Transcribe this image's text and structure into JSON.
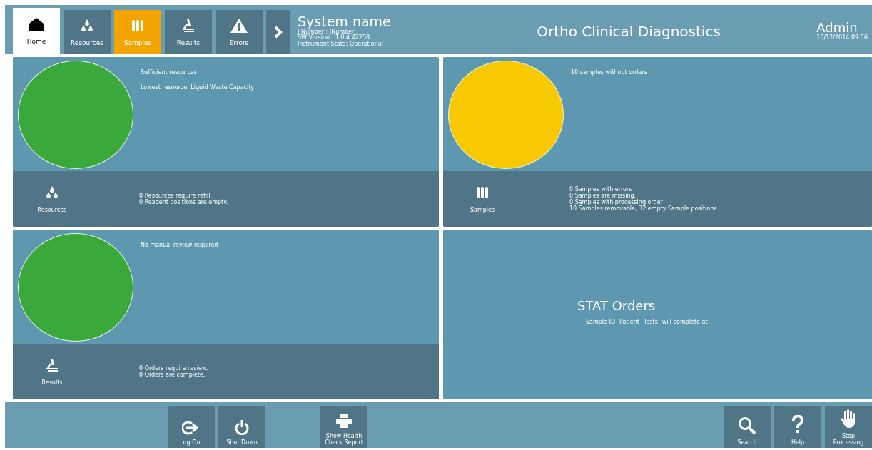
{
  "nav_tabs": [
    {
      "label": "Home",
      "kind": "home",
      "selected": true,
      "highlighted": false
    },
    {
      "label": "Resources",
      "kind": "drops",
      "selected": false,
      "highlighted": false
    },
    {
      "label": "Samples",
      "kind": "tubes",
      "selected": false,
      "highlighted": true
    },
    {
      "label": "Results",
      "kind": "microscope",
      "selected": false,
      "highlighted": false
    },
    {
      "label": "Errors",
      "kind": "warning",
      "selected": false,
      "highlighted": false
    }
  ],
  "system": {
    "name": "System name",
    "lines": [
      "J Number :  JNumber",
      "SW Version :  1.0.4.42258",
      "Instrument State: Operational"
    ]
  },
  "brand": "Ortho Clinical Diagnostics",
  "user": {
    "name": "Admin",
    "datetime": "10/12/2014 09:56"
  },
  "panels": [
    {
      "color": "#3aa83a",
      "messages": [
        "Sufficient resources",
        "Lowest resource: Liquid Waste Capacity"
      ],
      "kind": "drops",
      "label": "Resources",
      "details": [
        "0 Resources require refill.",
        "0 Reagent positions are empty."
      ]
    },
    {
      "color": "#f8c800",
      "messages": [
        "10 samples without orders"
      ],
      "kind": "tubes",
      "label": "Samples",
      "details": [
        "0 Samples with errors",
        "0 Samples are missing.",
        "0 Samples with processing order",
        "10 Samples removable, 32 empty Sample positions"
      ]
    },
    {
      "color": "#3aa83a",
      "messages": [
        "No manual review required"
      ],
      "kind": "microscope",
      "label": "Results",
      "details": [
        "0 Orders require review.",
        "0 Orders are complete."
      ]
    }
  ],
  "stat_orders": {
    "title": "STAT Orders",
    "columns": [
      "Sample ID",
      "Patient",
      "Tests",
      "will complete at"
    ]
  },
  "footer": {
    "left_buttons": [
      {
        "label": "Log Out",
        "kind": "logout"
      },
      {
        "label": "Shut Down",
        "kind": "power"
      }
    ],
    "center_buttons": [
      {
        "label": "Show Health Check Report",
        "kind": "printer"
      }
    ],
    "right_buttons": [
      {
        "label": "Search",
        "kind": "search"
      },
      {
        "label": "Help",
        "kind": "help"
      },
      {
        "label": "Stop Processing",
        "kind": "hand"
      }
    ]
  }
}
